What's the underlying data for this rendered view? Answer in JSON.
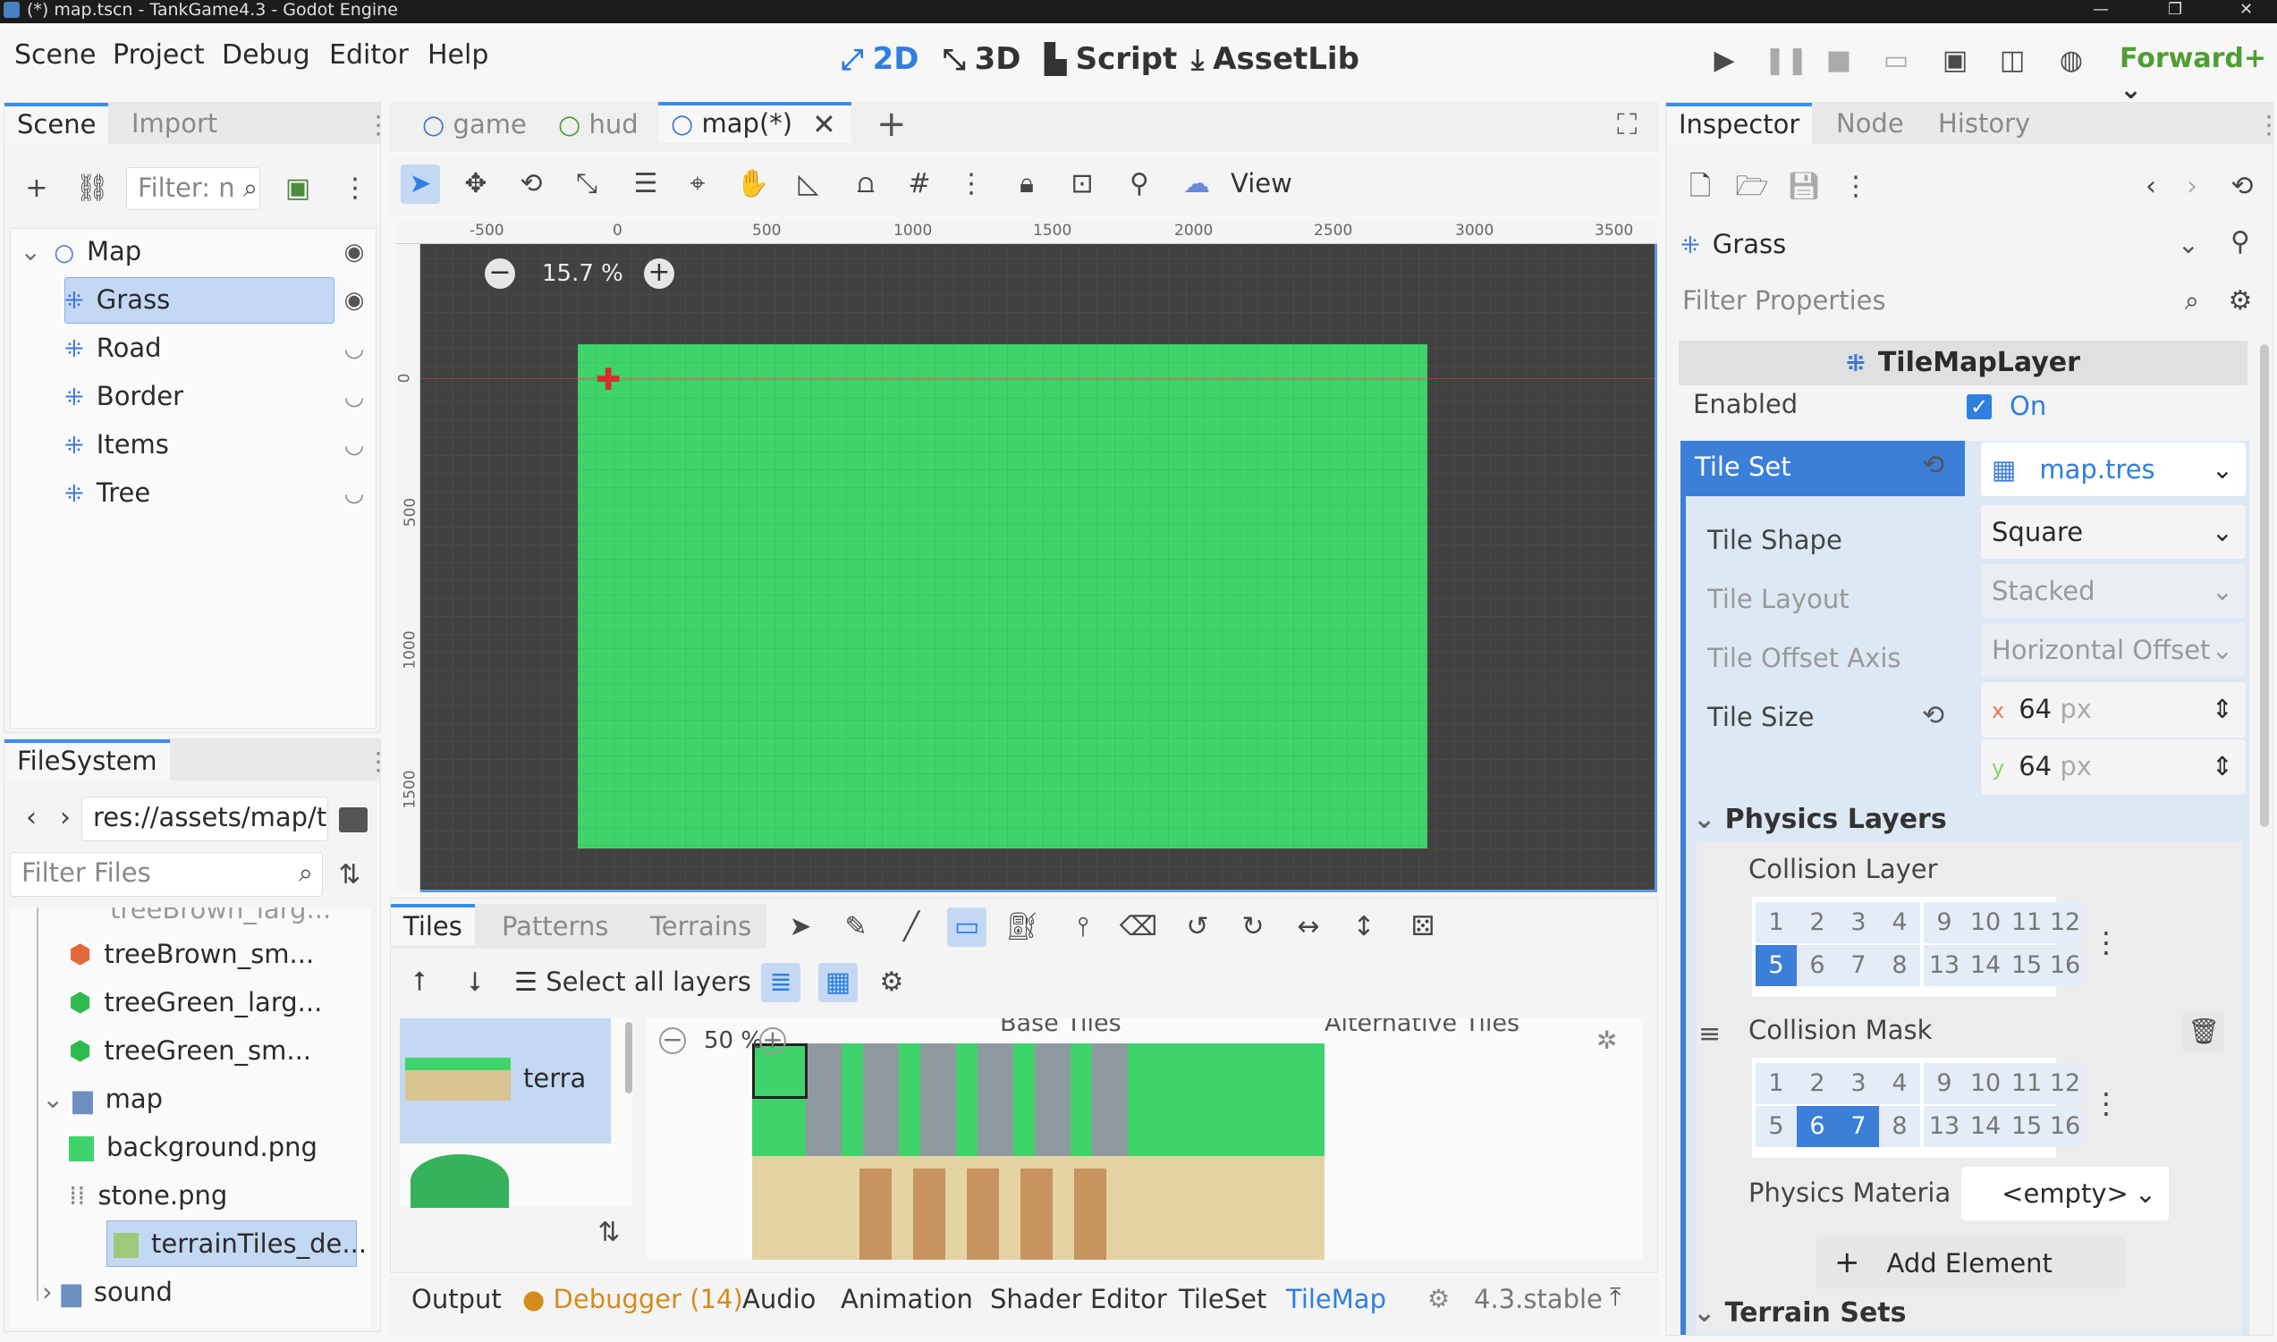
{
  "window": {
    "title": "(*) map.tscn - TankGame4.3 - Godot Engine"
  },
  "menu": {
    "items": [
      "Scene",
      "Project",
      "Debug",
      "Editor",
      "Help"
    ]
  },
  "modes": {
    "m2d": "2D",
    "m3d": "3D",
    "script": "Script",
    "assetlib": "AssetLib"
  },
  "renderer": "Forward+",
  "scene_dock": {
    "tabs": [
      "Scene",
      "Import"
    ],
    "filter_placeholder": "Filter: n",
    "tree": [
      "Map",
      "Grass",
      "Road",
      "Border",
      "Items",
      "Tree"
    ]
  },
  "filesystem": {
    "tab": "FileSystem",
    "path": "res://assets/map/t",
    "filter_placeholder": "Filter Files",
    "rows": [
      "treeBrown_sm...",
      "treeGreen_larg...",
      "treeGreen_sm...",
      "map",
      "background.png",
      "stone.png",
      "terrainTiles_de...",
      "sound"
    ]
  },
  "editor_tabs": [
    "game",
    "hud",
    "map(*)"
  ],
  "toolbar": {
    "view_label": "View"
  },
  "viewport": {
    "zoom": "15.7 %",
    "ruler_h": [
      "-500",
      "0",
      "500",
      "1000",
      "1500",
      "2000",
      "2500",
      "3000",
      "3500"
    ],
    "ruler_v": [
      "0",
      "500",
      "1000",
      "1500"
    ]
  },
  "tilemap_panel": {
    "tabs": [
      "Tiles",
      "Patterns",
      "Terrains"
    ],
    "select_all": "Select all layers",
    "source_name": "terra",
    "atlas_zoom": "50 %",
    "base_tiles": "Base Tiles",
    "alt_tiles": "Alternative Tiles"
  },
  "bottom": {
    "tabs": [
      "Output",
      "Debugger (14)",
      "Audio",
      "Animation",
      "Shader Editor",
      "TileSet",
      "TileMap"
    ],
    "version": "4.3.stable"
  },
  "inspector": {
    "tabs": [
      "Inspector",
      "Node",
      "History"
    ],
    "node": "Grass",
    "filter_placeholder": "Filter Properties",
    "class_name": "TileMapLayer",
    "enabled_label": "Enabled",
    "enabled_value": "On",
    "tile_set_label": "Tile Set",
    "tile_set_value": "map.tres",
    "tile_shape_label": "Tile Shape",
    "tile_shape_value": "Square",
    "tile_layout_label": "Tile Layout",
    "tile_layout_value": "Stacked",
    "tile_offset_label": "Tile Offset Axis",
    "tile_offset_value": "Horizontal Offset",
    "tile_size_label": "Tile Size",
    "tile_size_x": "64",
    "tile_size_y": "64",
    "px": "px",
    "physics_layers": "Physics Layers",
    "collision_layer": "Collision Layer",
    "collision_mask": "Collision Mask",
    "physics_material_label": "Physics Materia",
    "physics_material_value": "<empty>",
    "add_element": "Add Element",
    "terrain_sets": "Terrain Sets"
  },
  "colors": {
    "accent": "#3b8cf0",
    "grass": "#3fd36c",
    "canvas": "#414141",
    "renderer": "#4f9e34"
  }
}
